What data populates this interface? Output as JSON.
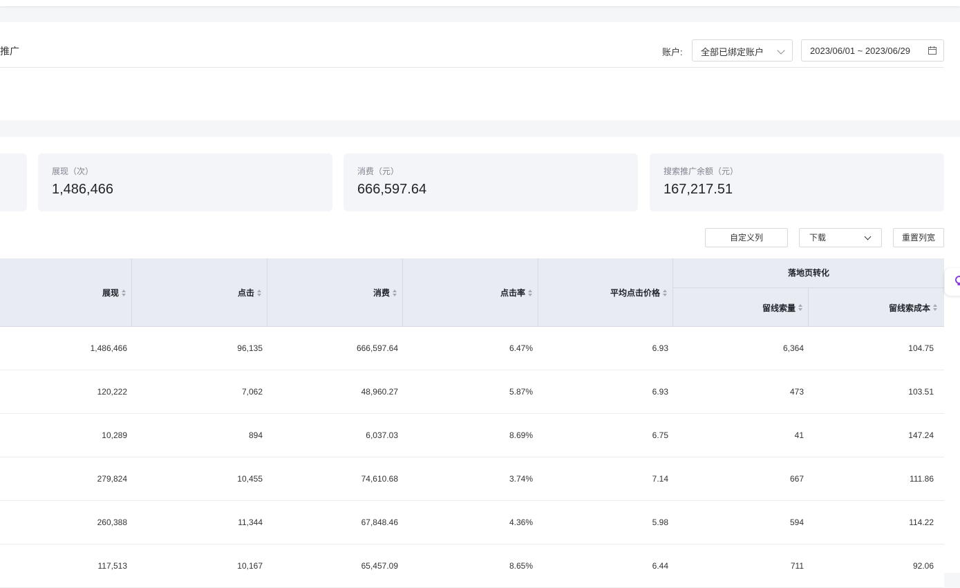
{
  "filter": {
    "crumb": "推广",
    "account_label": "账户:",
    "account_value": "全部已绑定账户",
    "date_range": "2023/06/01 ~ 2023/06/29"
  },
  "cards": [
    {
      "label": "展现（次）",
      "value": "1,486,466"
    },
    {
      "label": "消费（元）",
      "value": "666,597.64"
    },
    {
      "label": "搜索推广余额（元）",
      "value": "167,217.51"
    }
  ],
  "toolbar": {
    "custom_columns": "自定义列",
    "download": "下载",
    "reset_width": "重置列宽"
  },
  "table": {
    "columns": [
      "展现",
      "点击",
      "消费",
      "点击率",
      "平均点击价格"
    ],
    "group_label": "落地页转化",
    "group_columns": [
      "留线索量",
      "留线索成本"
    ],
    "rows": [
      [
        "1,486,466",
        "96,135",
        "666,597.64",
        "6.47%",
        "6.93",
        "6,364",
        "104.75"
      ],
      [
        "120,222",
        "7,062",
        "48,960.27",
        "5.87%",
        "6.93",
        "473",
        "103.51"
      ],
      [
        "10,289",
        "894",
        "6,037.03",
        "8.69%",
        "6.75",
        "41",
        "147.24"
      ],
      [
        "279,824",
        "10,455",
        "74,610.68",
        "3.74%",
        "7.14",
        "667",
        "111.86"
      ],
      [
        "260,388",
        "11,344",
        "67,848.46",
        "4.36%",
        "5.98",
        "594",
        "114.22"
      ],
      [
        "117,513",
        "10,167",
        "65,457.09",
        "8.65%",
        "6.44",
        "711",
        "92.06"
      ]
    ]
  }
}
